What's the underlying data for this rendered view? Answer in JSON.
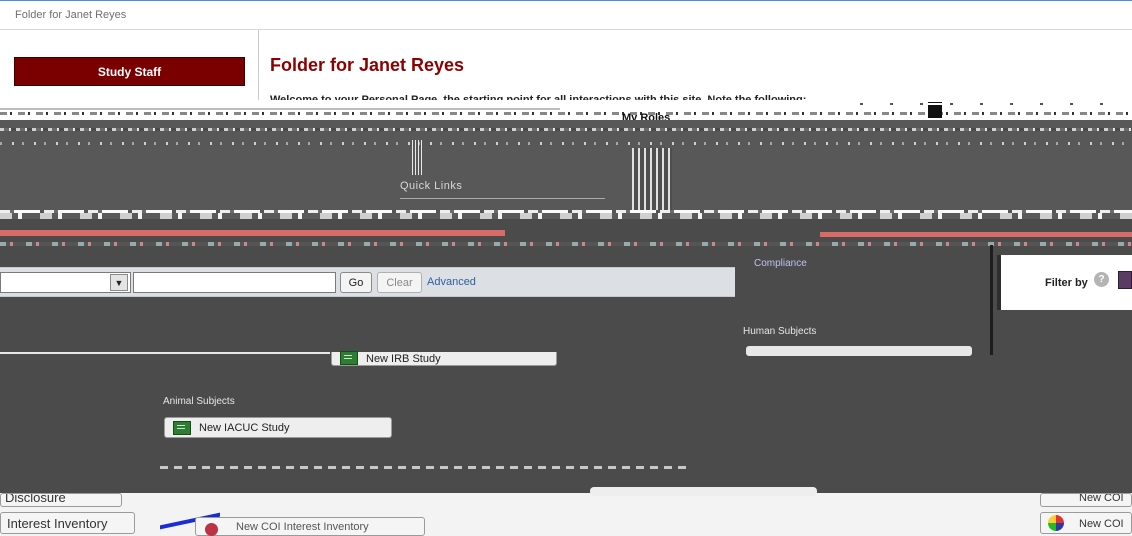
{
  "window": {
    "title": "Folder for Janet Reyes"
  },
  "sidebar": {
    "study_staff_label": "Study Staff"
  },
  "header": {
    "page_title": "Folder for Janet Reyes",
    "welcome_text": "Welcome to your Personal Page, the starting point for all interactions with this site. Note the following:",
    "my_roles_label": "My Roles"
  },
  "quick_links": {
    "label": "Quick Links"
  },
  "search": {
    "go_label": "Go",
    "clear_label": "Clear",
    "advanced_label": "Advanced"
  },
  "filter": {
    "label": "Filter by",
    "help_glyph": "?"
  },
  "create": {
    "compliance_label": "Compliance",
    "human_subjects_label": "Human Subjects",
    "new_irb_label": "New IRB Study",
    "animal_subjects_label": "Animal Subjects",
    "new_iacuc_label": "New IACUC Study"
  },
  "bottom": {
    "disclosure_label": "Disclosure",
    "interest_inventory_label": "Interest Inventory",
    "new_coi_inventory_label": "New COI Interest Inventory",
    "new_coi_label_1": "New COI",
    "new_coi_label_2": "New COI"
  },
  "colors": {
    "brand_maroon": "#7a0000",
    "title_red": "#8b0000",
    "link_blue": "#2f5f9f",
    "toolbar_bg": "#dcdfe4",
    "overlay_gray": "#4b4b4b"
  }
}
